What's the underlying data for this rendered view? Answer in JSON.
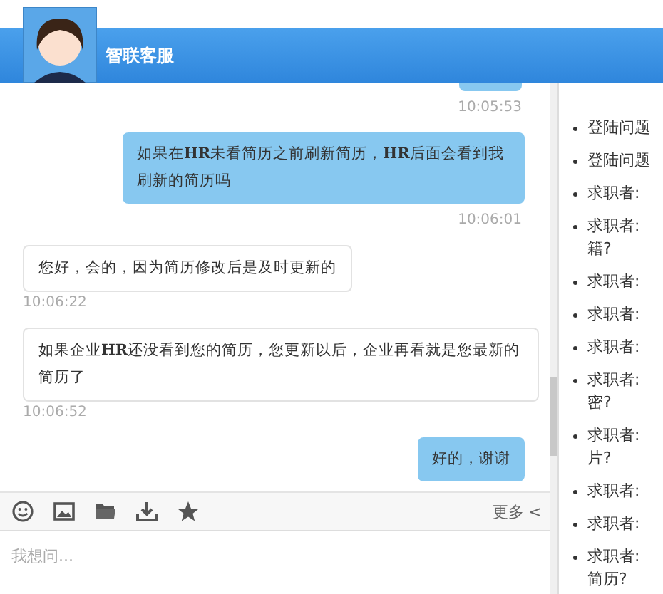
{
  "header": {
    "title": "智联客服"
  },
  "messages": [
    {
      "kind": "time_sent",
      "time": "10:05:53"
    },
    {
      "kind": "sent",
      "text": "如果在**HR**未看简历之前刷新简历，**HR**后面会看到我刷新的简历吗",
      "time": "10:06:01"
    },
    {
      "kind": "received",
      "text": "您好，会的，因为简历修改后是及时更新的",
      "time": "10:06:22"
    },
    {
      "kind": "received",
      "text": "如果企业**HR**还没看到您的简历，您更新以后，企业再看就是您最新的简历了",
      "time": "10:06:52"
    },
    {
      "kind": "sent",
      "text": "好的，谢谢"
    }
  ],
  "toolbar": {
    "more": "更多 <"
  },
  "input": {
    "placeholder": "我想问..."
  },
  "faq": [
    {
      "lines": [
        "登陆问题"
      ]
    },
    {
      "lines": [
        "登陆问题"
      ]
    },
    {
      "lines": [
        "求职者:"
      ]
    },
    {
      "lines": [
        "求职者:",
        "籍?"
      ]
    },
    {
      "lines": [
        "求职者:"
      ]
    },
    {
      "lines": [
        "求职者:"
      ]
    },
    {
      "lines": [
        "求职者:"
      ]
    },
    {
      "lines": [
        "求职者:",
        "密?"
      ]
    },
    {
      "lines": [
        "求职者:",
        "片?"
      ]
    },
    {
      "lines": [
        "求职者:"
      ]
    },
    {
      "lines": [
        "求职者:"
      ]
    },
    {
      "lines": [
        "求职者:",
        "简历?"
      ]
    }
  ]
}
